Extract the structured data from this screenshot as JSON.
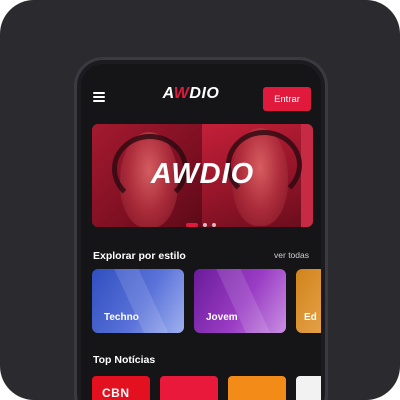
{
  "app": {
    "logo_text_a": "A",
    "logo_text_w": "W",
    "logo_text_rest": "DIO"
  },
  "header": {
    "login_label": "Entrar"
  },
  "banner": {
    "brand_text": "AWDIO",
    "dots": 3,
    "active_dot": 0
  },
  "explore": {
    "title": "Explorar por estilo",
    "see_all": "ver todas",
    "genres": [
      {
        "label": "Techno"
      },
      {
        "label": "Jovem"
      },
      {
        "label": "Ed"
      }
    ]
  },
  "news": {
    "title": "Top Notícias",
    "items": [
      {
        "brand": "CBN"
      },
      {
        "brand": ""
      },
      {
        "brand": ""
      },
      {
        "brand": ""
      }
    ]
  },
  "colors": {
    "accent": "#e11a3d",
    "background": "#151517"
  }
}
